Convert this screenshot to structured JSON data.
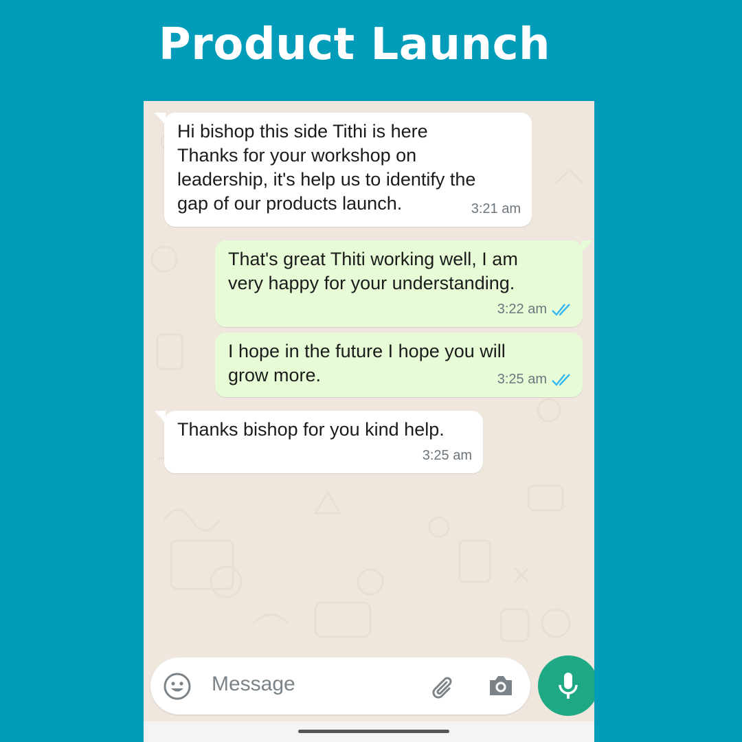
{
  "page": {
    "title": "Product Launch"
  },
  "colors": {
    "page_background": "#009cb9",
    "chat_background": "#efe7dd",
    "incoming_bubble": "#ffffff",
    "outgoing_bubble": "#e7fcd6",
    "read_ticks": "#34b7f1",
    "mic_button": "#1ea884"
  },
  "messages": [
    {
      "direction": "incoming",
      "text": "Hi bishop this side Tithi is here\nThanks for your workshop on\nleadership, it's help us to identify the\ngap of our products launch.",
      "time": "3:21 am"
    },
    {
      "direction": "outgoing",
      "text": "That's great Thiti working well, I am\nvery happy for your understanding.",
      "time": "3:22 am",
      "status_icon": "double-check-read-icon"
    },
    {
      "direction": "outgoing",
      "text": "I hope in the future I hope you will\ngrow more.",
      "time": "3:25 am",
      "status_icon": "double-check-read-icon"
    },
    {
      "direction": "incoming",
      "text": "Thanks bishop for you kind help.",
      "time": "3:25 am"
    }
  ],
  "composer": {
    "placeholder": "Message",
    "icons": [
      "emoji-icon",
      "attach-icon",
      "camera-icon"
    ],
    "send_icon": "microphone-icon"
  }
}
